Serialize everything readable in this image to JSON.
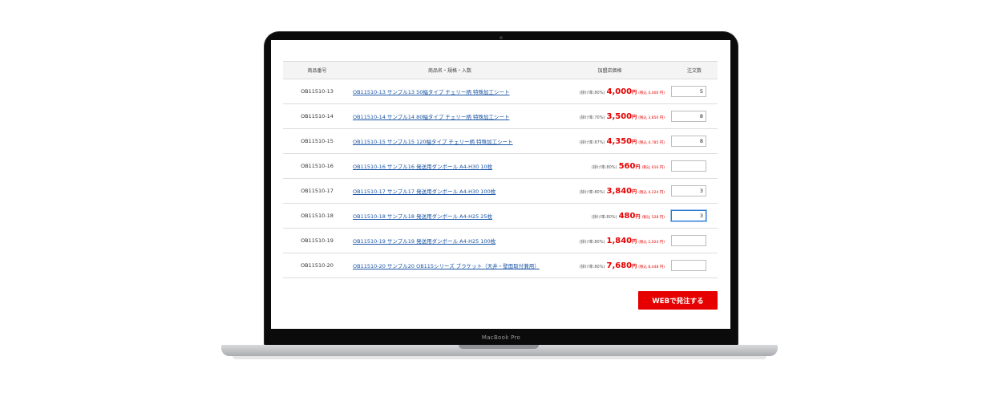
{
  "device": {
    "label": "MacBook Pro"
  },
  "table": {
    "headers": {
      "code": "商品番号",
      "name": "商品名・規格・入数",
      "price": "加盟店価格",
      "qty": "注文数"
    },
    "rows": [
      {
        "code": "OB11510-13",
        "name": "OB11510-13 サンプル13 50幅タイプ チェリー柄 特殊加工シート",
        "rate": "(掛け率:80%)",
        "price": "4,000",
        "yen": "円",
        "tax": "(税込 4,400 円)",
        "qty": "5"
      },
      {
        "code": "OB11510-14",
        "name": "OB11510-14 サンプル14 80幅タイプ チェリー柄 特殊加工シート",
        "rate": "(掛け率:70%)",
        "price": "3,500",
        "yen": "円",
        "tax": "(税込 3,850 円)",
        "qty": "8"
      },
      {
        "code": "OB11510-15",
        "name": "OB11510-15 サンプル15 120幅タイプ チェリー柄 特殊加工シート",
        "rate": "(掛け率:87%)",
        "price": "4,350",
        "yen": "円",
        "tax": "(税込 4,785 円)",
        "qty": "8"
      },
      {
        "code": "OB11510-16",
        "name": "OB11510-16 サンプル16 発送用ダンボール A4-H30 10枚",
        "rate": "(掛け率:80%)",
        "price": "560",
        "yen": "円",
        "tax": "(税込 616 円)",
        "qty": ""
      },
      {
        "code": "OB11510-17",
        "name": "OB11510-17 サンプル17 発送用ダンボール A4-H30 100枚",
        "rate": "(掛け率:80%)",
        "price": "3,840",
        "yen": "円",
        "tax": "(税込 4,224 円)",
        "qty": "3"
      },
      {
        "code": "OB11510-18",
        "name": "OB11510-18 サンプル18 発送用ダンボール A4-H25 25枚",
        "rate": "(掛け率:80%)",
        "price": "480",
        "yen": "円",
        "tax": "(税込 528 円)",
        "qty": "3"
      },
      {
        "code": "OB11510-19",
        "name": "OB11510-19 サンプル19 発送用ダンボール A4-H25 100枚",
        "rate": "(掛け率:80%)",
        "price": "1,840",
        "yen": "円",
        "tax": "(税込 2,024 円)",
        "qty": ""
      },
      {
        "code": "OB11510-20",
        "name": "OB11510-20 サンプル20 OB115シリーズ ブラケット（天井・壁面取付兼用）",
        "rate": "(掛け率:80%)",
        "price": "7,680",
        "yen": "円",
        "tax": "(税込 8,448 円)",
        "qty": ""
      }
    ]
  },
  "order_button": {
    "label": "WEBで発注する"
  },
  "colors": {
    "accent": "#e60000",
    "link": "#1a55a5",
    "focus": "#2a78d6"
  }
}
